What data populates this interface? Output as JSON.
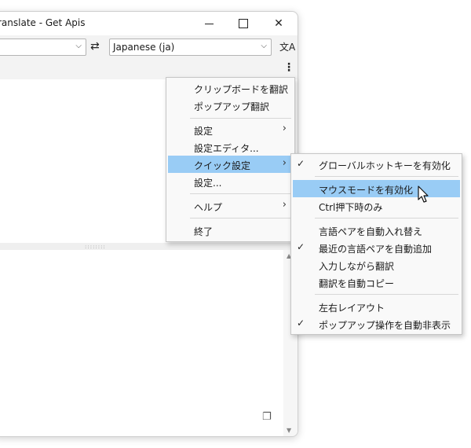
{
  "window": {
    "title": "Translate - Get Apis",
    "title_visible": "ranslate - Get Apis",
    "controls": {
      "minimize_icon": "minimize-icon",
      "maximize_icon": "maximize-icon",
      "close_icon": "close-icon"
    }
  },
  "toolbar": {
    "source_language": "",
    "target_language": "Japanese (ja)",
    "swap_icon": "⇄",
    "translate_icon": "文A",
    "more_icon": "⋮"
  },
  "main_menu": {
    "items": [
      {
        "label": "クリップボードを翻訳"
      },
      {
        "label": "ポップアップ翻訳"
      },
      {
        "label": "設定",
        "submenu": true
      },
      {
        "label": "設定エディタ..."
      },
      {
        "label": "クイック設定",
        "submenu": true,
        "highlighted": true
      },
      {
        "label": "設定..."
      },
      {
        "label": "ヘルプ",
        "submenu": true
      },
      {
        "label": "終了"
      }
    ]
  },
  "quick_settings_menu": {
    "items": [
      {
        "label": "グローバルホットキーを有効化",
        "checked": true
      },
      {
        "label": "マウスモードを有効化",
        "checked": false,
        "highlighted": true
      },
      {
        "label": "Ctrl押下時のみ",
        "checked": false
      },
      {
        "label": "言語ペアを自動入れ替え",
        "checked": false
      },
      {
        "label": "最近の言語ペアを自動追加",
        "checked": true
      },
      {
        "label": "入力しながら翻訳",
        "checked": false
      },
      {
        "label": "翻訳を自動コピー",
        "checked": false
      },
      {
        "label": "左右レイアウト",
        "checked": false
      },
      {
        "label": "ポップアップ操作を自動非表示",
        "checked": true
      }
    ]
  },
  "glyphs": {
    "check": "✓",
    "submenu_arrow": "›",
    "chevron_down": "⌵",
    "grip": "::::::::",
    "copy": "❐",
    "scroll_up": "▲",
    "scroll_down": "▼"
  },
  "colors": {
    "highlight": "#99ccf5",
    "menu_bg": "#f9f9f9",
    "toolbar_bg": "#f3f3f3"
  }
}
